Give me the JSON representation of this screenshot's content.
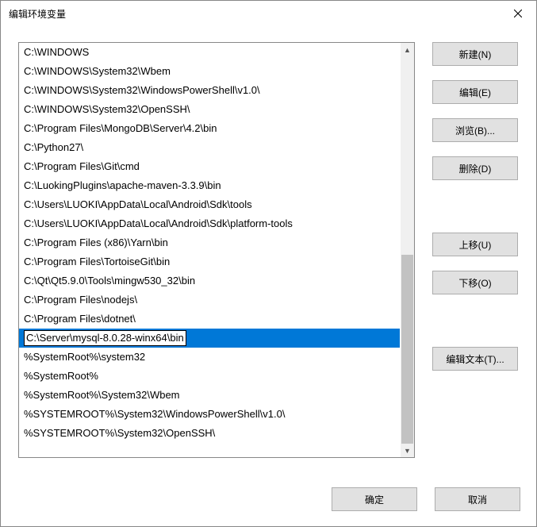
{
  "window": {
    "title": "编辑环境变量"
  },
  "list": {
    "items": [
      "C:\\WINDOWS",
      "C:\\WINDOWS\\System32\\Wbem",
      "C:\\WINDOWS\\System32\\WindowsPowerShell\\v1.0\\",
      "C:\\WINDOWS\\System32\\OpenSSH\\",
      "C:\\Program Files\\MongoDB\\Server\\4.2\\bin",
      "C:\\Python27\\",
      "C:\\Program Files\\Git\\cmd",
      "C:\\LuokingPlugins\\apache-maven-3.3.9\\bin",
      "C:\\Users\\LUOKI\\AppData\\Local\\Android\\Sdk\\tools",
      "C:\\Users\\LUOKI\\AppData\\Local\\Android\\Sdk\\platform-tools",
      "C:\\Program Files (x86)\\Yarn\\bin",
      "C:\\Program Files\\TortoiseGit\\bin",
      "C:\\Qt\\Qt5.9.0\\Tools\\mingw530_32\\bin",
      "C:\\Program Files\\nodejs\\",
      "C:\\Program Files\\dotnet\\",
      "C:\\Server\\mysql-8.0.28-winx64\\bin",
      "%SystemRoot%\\system32",
      "%SystemRoot%",
      "%SystemRoot%\\System32\\Wbem",
      "%SYSTEMROOT%\\System32\\WindowsPowerShell\\v1.0\\",
      "%SYSTEMROOT%\\System32\\OpenSSH\\"
    ],
    "selected_index": 15,
    "edit_value": "C:\\Server\\mysql-8.0.28-winx64\\bin"
  },
  "buttons": {
    "new": "新建(N)",
    "edit": "编辑(E)",
    "browse": "浏览(B)...",
    "delete": "删除(D)",
    "move_up": "上移(U)",
    "move_down": "下移(O)",
    "edit_text": "编辑文本(T)...",
    "ok": "确定",
    "cancel": "取消"
  }
}
